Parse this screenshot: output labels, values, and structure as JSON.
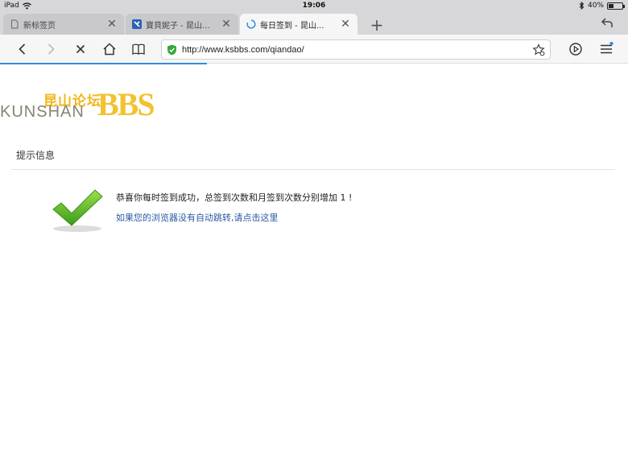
{
  "status_bar": {
    "device": "iPad",
    "time": "19:06",
    "battery_label": "40%",
    "battery_level": 0.4
  },
  "tabs": [
    {
      "label": "新标签页",
      "close": "✕",
      "active": false
    },
    {
      "label": "寶貝妮子 - 昆山...",
      "close": "✕",
      "active": false
    },
    {
      "label": "每日签到 - 昆山...",
      "close": "✕",
      "active": true
    }
  ],
  "new_tab": "+",
  "address_bar": {
    "url": "http://www.ksbbs.com/qiandao/"
  },
  "load_progress": 0.33,
  "logo": {
    "cn": "昆山论坛",
    "en": "KUNSHAN",
    "bbs": "BBS"
  },
  "page": {
    "section_title": "提示信息",
    "message": "恭喜你每时签到成功，总签到次数和月签到次数分别增加 1 !",
    "redirect_link": "如果您的浏览器没有自动跳转,请点击这里"
  },
  "colors": {
    "link": "#2a5aa5",
    "accent": "#2f8de4",
    "logo_yellow": "#f2c230",
    "check_green": "#5cb82b"
  },
  "icons": [
    "wifi-icon",
    "bluetooth-icon",
    "page-icon",
    "site-favicon",
    "loading-spinner-icon",
    "back-arrow-icon",
    "forward-arrow-icon",
    "stop-icon",
    "home-icon",
    "bookmarks-book-icon",
    "security-shield-icon",
    "star-settings-icon",
    "play-circle-icon",
    "menu-icon",
    "checkmark-icon"
  ]
}
